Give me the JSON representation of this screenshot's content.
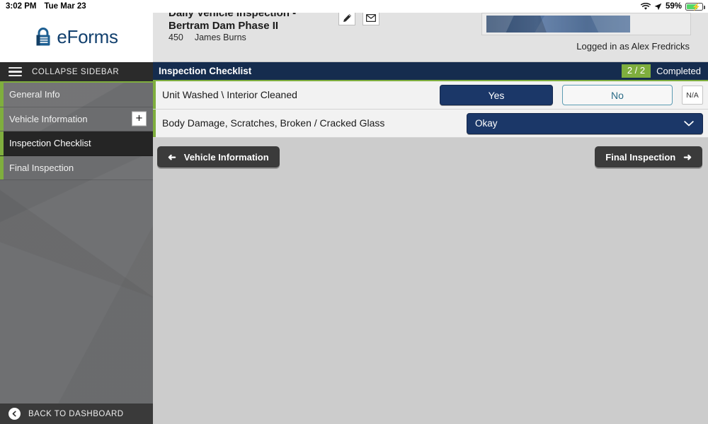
{
  "statusbar": {
    "time": "3:02 PM",
    "date": "Tue Mar 23",
    "wifi_icon": "wifi-icon",
    "location_icon": "location-arrow-icon",
    "battery_percent": "59%",
    "battery_icon": "battery-charging-icon"
  },
  "sidebar": {
    "logo": {
      "icon": "lock-icon",
      "text": "eForms"
    },
    "collapse": {
      "icon": "hamburger-icon",
      "label": "COLLAPSE SIDEBAR"
    },
    "items": [
      {
        "label": "General Info",
        "active": false,
        "has_plus": false
      },
      {
        "label": "Vehicle Information",
        "active": false,
        "has_plus": true,
        "plus_label": "+"
      },
      {
        "label": "Inspection Checklist",
        "active": true,
        "has_plus": false
      },
      {
        "label": "Final Inspection",
        "active": false,
        "has_plus": false
      }
    ],
    "bottom": {
      "icon": "back-circle-icon",
      "label": "BACK TO DASHBOARD"
    },
    "accent_color": "#7fae3e"
  },
  "header": {
    "title": "Daily Vehicle Inspection - Bertram Dam Phase II",
    "form_number": "450",
    "author": "James  Burns",
    "edit_icon": "pencil-icon",
    "mail_icon": "envelope-icon",
    "signature_label": "signature-banner",
    "logged_in": "Logged in as Alex Fredricks"
  },
  "section": {
    "title": "Inspection Checklist",
    "count": "2 / 2",
    "completed_label": "Completed",
    "bar_color": "#152c4e",
    "badge_color": "#7fae3e"
  },
  "questions": [
    {
      "text": "Unit Washed \\ Interior Cleaned",
      "type": "yesno",
      "yes_label": "Yes",
      "no_label": "No",
      "na_label": "N/A",
      "selected": "Yes"
    },
    {
      "text": "Body Damage, Scratches, Broken / Cracked Glass",
      "type": "dropdown",
      "value": "Okay",
      "chevron_icon": "chevron-down-icon"
    }
  ],
  "footer_nav": {
    "back_label": "Vehicle Information",
    "back_icon": "arrow-left-icon",
    "next_label": "Final Inspection",
    "next_icon": "arrow-right-icon"
  }
}
